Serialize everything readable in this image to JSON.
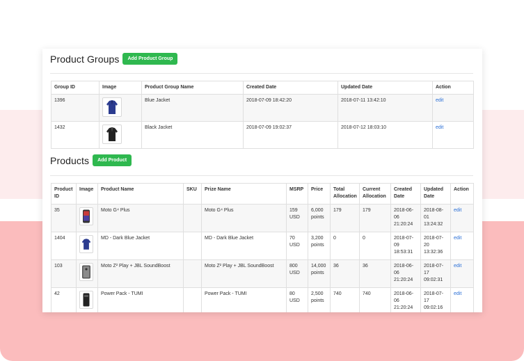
{
  "groups": {
    "title": "Product Groups",
    "add_button": "Add Product Group",
    "columns": [
      "Group ID",
      "Image",
      "Product Group Name",
      "Created Date",
      "Updated Date",
      "Action"
    ],
    "rows": [
      {
        "id": "1396",
        "image": "blue-jacket-image",
        "name": "Blue Jacket",
        "created": "2018-07-09 18:42:20",
        "updated": "2018-07-11 13:42:10",
        "action": "edit"
      },
      {
        "id": "1432",
        "image": "black-jacket-image",
        "name": "Black Jacket",
        "created": "2018-07-09 19:02:37",
        "updated": "2018-07-12 18:03:10",
        "action": "edit"
      }
    ]
  },
  "products": {
    "title": "Products",
    "add_button": "Add Product",
    "columns": [
      "Product ID",
      "Image",
      "Product Name",
      "SKU",
      "Prize Name",
      "MSRP",
      "Price",
      "Total Allocation",
      "Current Allocation",
      "Created Date",
      "Updated Date",
      "Action"
    ],
    "rows": [
      {
        "id": "35",
        "image": "phone-image",
        "name": "Moto G⁴ Plus",
        "sku": "",
        "prize": "Moto G⁴ Plus",
        "msrp": "159 USD",
        "price": "6,000 points",
        "total": "179",
        "current": "179",
        "created": "2018-06-06 21:20:24",
        "updated": "2018-08-01 13:24:32",
        "action": "edit"
      },
      {
        "id": "1404",
        "image": "blue-jacket-image",
        "name": "MD - Dark Blue Jacket",
        "sku": "",
        "prize": "MD - Dark Blue Jacket",
        "msrp": "70 USD",
        "price": "3,200 points",
        "total": "0",
        "current": "0",
        "created": "2018-07-09 18:53:31",
        "updated": "2018-07-20 13:32:36",
        "action": "edit"
      },
      {
        "id": "103",
        "image": "phone-speaker-image",
        "name": "Moto Z² Play + JBL SoundBoost",
        "sku": "",
        "prize": "Moto Z² Play + JBL SoundBoost",
        "msrp": "800 USD",
        "price": "14,000 points",
        "total": "36",
        "current": "36",
        "created": "2018-06-06 21:20:24",
        "updated": "2018-07-17 09:02:31",
        "action": "edit"
      },
      {
        "id": "42",
        "image": "power-pack-image",
        "name": "Power Pack - TUMI",
        "sku": "",
        "prize": "Power Pack - TUMI",
        "msrp": "80 USD",
        "price": "2,500 points",
        "total": "740",
        "current": "740",
        "created": "2018-06-06 21:20:24",
        "updated": "2018-07-17 09:02:16",
        "action": "edit"
      }
    ]
  },
  "colors": {
    "accent_green": "#2fb84f",
    "link_blue": "#2a6fd6",
    "band_light": "#fdeced",
    "band_strong": "#fbbcbd"
  }
}
